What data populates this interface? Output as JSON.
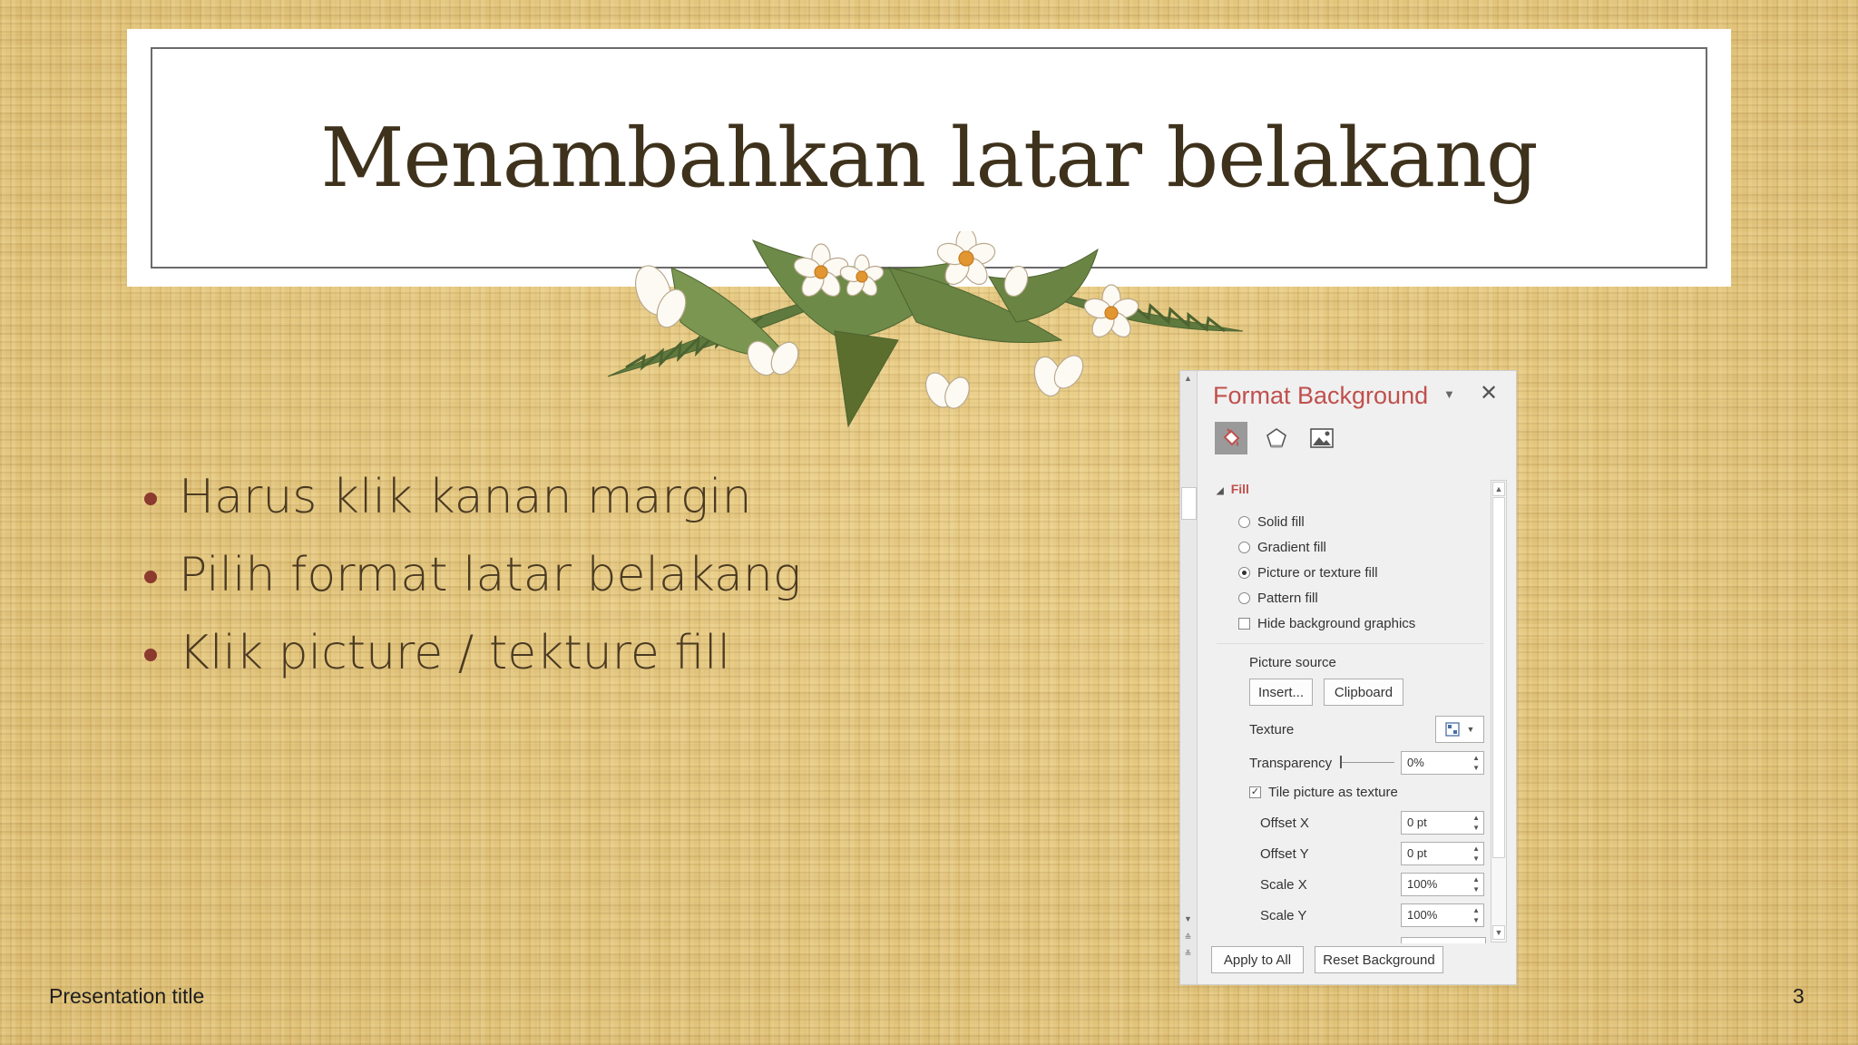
{
  "slide": {
    "title": "Menambahkan latar belakang",
    "bullets": [
      "Harus klik kanan margin",
      "Pilih format latar belakang",
      "Klik picture / tekture fill"
    ],
    "footer_title": "Presentation title",
    "page_number": "3"
  },
  "pane": {
    "title": "Format Background",
    "tabs": [
      "fill-icon",
      "effects-icon",
      "picture-icon"
    ],
    "section": "Fill",
    "options": {
      "solid": "Solid fill",
      "gradient": "Gradient fill",
      "picture": "Picture or texture fill",
      "pattern": "Pattern fill",
      "hide": "Hide background graphics"
    },
    "selected_option": "Picture or texture fill",
    "picture_source_label": "Picture source",
    "insert_button": "Insert...",
    "clipboard_button": "Clipboard",
    "texture_label": "Texture",
    "transparency_label": "Transparency",
    "transparency_value": "0%",
    "tile_label": "Tile picture as texture",
    "tile_checked": true,
    "offset_x_label": "Offset X",
    "offset_x_value": "0 pt",
    "offset_y_label": "Offset Y",
    "offset_y_value": "0 pt",
    "scale_x_label": "Scale X",
    "scale_x_value": "100%",
    "scale_y_label": "Scale Y",
    "scale_y_value": "100%",
    "apply_all_button": "Apply to All",
    "reset_button": "Reset Background"
  },
  "colors": {
    "accent": "#c0504d",
    "title_text": "#3f321c",
    "bullet": "#8b3a2e",
    "background": "#e3c57c"
  }
}
